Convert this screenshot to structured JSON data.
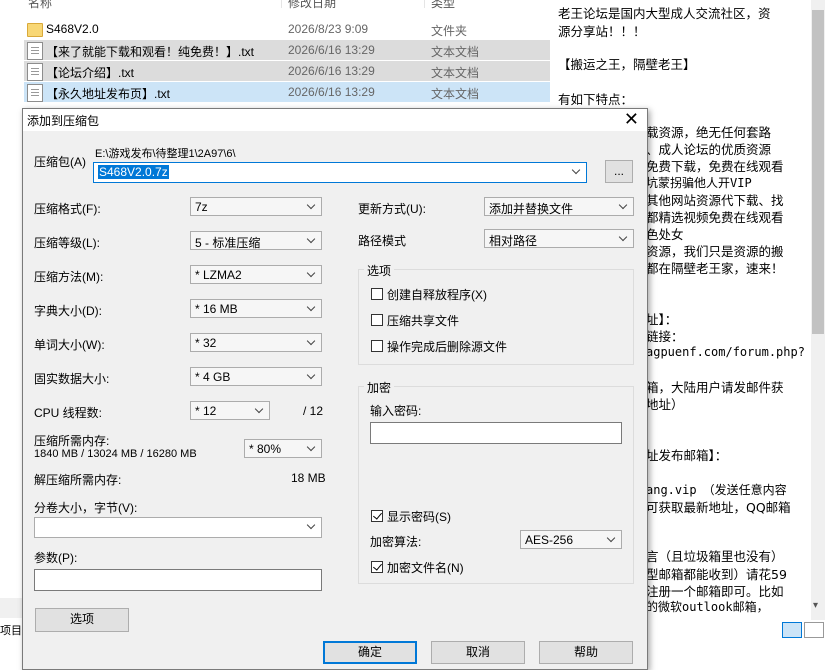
{
  "explorer": {
    "headers": {
      "name": "名称",
      "date": "修改日期",
      "type": "类型"
    },
    "files": [
      {
        "name": "S468V2.0",
        "date": "2026/8/23 9:09",
        "type": "文件夹",
        "icon": "folder-icon"
      },
      {
        "name": "【来了就能下载和观看！纯免费！】.txt",
        "date": "2026/6/16 13:29",
        "type": "文本文档",
        "icon": "text-file-icon"
      },
      {
        "name": "【论坛介绍】.txt",
        "date": "2026/6/16 13:29",
        "type": "文本文档",
        "icon": "text-file-icon"
      },
      {
        "name": "【永久地址发布页】.txt",
        "date": "2026/6/16 13:29",
        "type": "文本文档",
        "icon": "text-file-icon"
      }
    ],
    "status_left": "项目"
  },
  "viewer": {
    "lines": [
      "老王论坛是国内大型成人交流社区，资",
      "源分享站！！！",
      "【搬运之王，隔壁老王】",
      "有如下特点：",
      "载资源，绝无任何套路",
      "、成人论坛的优质资源",
      "免费下载，免费在线观看",
      "坑蒙拐骗他人开VIP",
      "其他网站资源代下载、找",
      "都精选视频免费在线观看",
      "色处女",
      "资源，我们只是资源的搬",
      "都在隔壁老王家，速来！",
      "址】：",
      "链接：",
      "agpuenf.com/forum.php?",
      "箱，大陆用户请发邮件获",
      "地址）",
      "址发布邮箱】：",
      "ang.vip　（发送任意内容",
      "可获取最新地址，QQ邮箱",
      "言（且垃圾箱里也没有）",
      "型邮箱都能收到）请花59",
      "注册一个邮箱即可。比如",
      "的微软outlook邮箱，"
    ]
  },
  "dialog": {
    "title": "添加到压缩包",
    "archive_label": "压缩包(A)",
    "archive_path": "E:\\游戏发布\\待整理1\\2A97\\6\\",
    "archive_name": "S468V2.0.7z",
    "browse_label": "...",
    "format_label": "压缩格式(F):",
    "format_value": "7z",
    "level_label": "压缩等级(L):",
    "level_value": "5 - 标准压缩",
    "method_label": "压缩方法(M):",
    "method_value": "* LZMA2",
    "dict_label": "字典大小(D):",
    "dict_value": "* 16 MB",
    "word_label": "单词大小(W):",
    "word_value": "* 32",
    "solid_label": "固实数据大小:",
    "solid_value": "* 4 GB",
    "cpu_label": "CPU 线程数:",
    "cpu_value": "* 12",
    "cpu_max": "/ 12",
    "mem_label": "压缩所需内存:",
    "mem_value": "1840 MB / 13024 MB / 16280 MB",
    "mem_pct": "* 80%",
    "decomp_label": "解压缩所需内存:",
    "decomp_value": "18 MB",
    "volume_label": "分卷大小，字节(V):",
    "params_label": "参数(P):",
    "options_btn": "选项",
    "update_label": "更新方式(U):",
    "update_value": "添加并替换文件",
    "path_label": "路径模式",
    "path_value": "相对路径",
    "options_group": "选项",
    "opt_sfx": "创建自释放程序(X)",
    "opt_shared": "压缩共享文件",
    "opt_delete": "操作完成后删除源文件",
    "enc_group": "加密",
    "pwd_label": "输入密码:",
    "show_pwd": "显示密码(S)",
    "enc_method_label": "加密算法:",
    "enc_method_value": "AES-256",
    "enc_names": "加密文件名(N)",
    "ok": "确定",
    "cancel": "取消",
    "help": "帮助"
  }
}
